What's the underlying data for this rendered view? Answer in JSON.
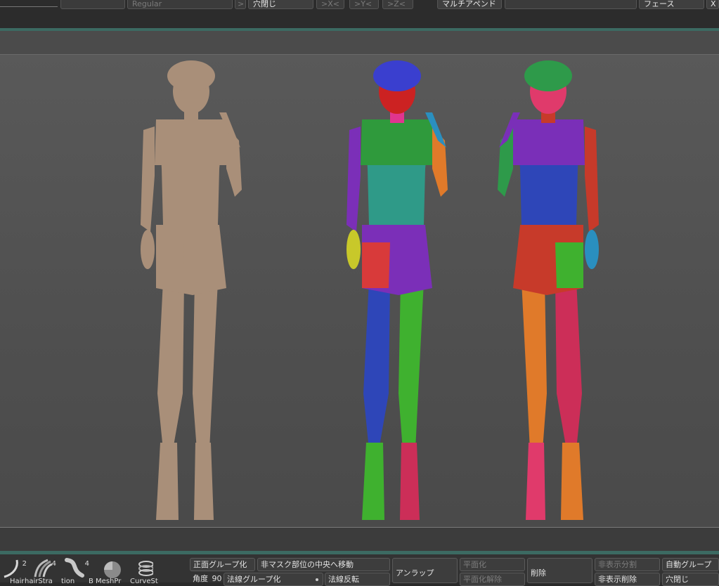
{
  "top_toolbar": {
    "font_style_value": "Regular",
    "arrow_label": ">",
    "close_holes_label": "穴閉じ",
    "axis_x_label": ">X<",
    "axis_y_label": ">Y<",
    "axis_z_label": ">Z<",
    "multi_append_label": "マルチアペンド",
    "face_label": "フェース",
    "close_label": "X"
  },
  "viewport": {
    "models": [
      {
        "name": "sculpt-front",
        "colors": [
          "#a98f79"
        ]
      },
      {
        "name": "polygroup-front",
        "colors": [
          "#cc2222",
          "#3a3fcf",
          "#2f9a3c",
          "#7b2fb8",
          "#2f9a88",
          "#d83a3a",
          "#2e46b8",
          "#3fb12f",
          "#c8c82a",
          "#cc2e58",
          "#e07a2a",
          "#2a8fbf",
          "#e0358f"
        ]
      },
      {
        "name": "polygroup-back",
        "colors": [
          "#e03a6b",
          "#2e9a4a",
          "#7a2fb8",
          "#c73a2a",
          "#2e46b8",
          "#3fb12f",
          "#cc2e58",
          "#e07a2a",
          "#2a8fbf"
        ]
      }
    ]
  },
  "brushes": [
    {
      "icon": "hair-curve-icon",
      "count": "2",
      "label": "Hair"
    },
    {
      "icon": "hair-strand-icon",
      "count": "4",
      "label": "hairStra"
    },
    {
      "icon": "tentacle-icon",
      "count": "4",
      "label": "tion"
    },
    {
      "icon": "sphere-icon",
      "count": "",
      "label": "B MeshPr"
    },
    {
      "icon": "curve-stroke-icon",
      "count": "",
      "label": "CurveSt"
    }
  ],
  "polygroups": {
    "front_group_label": "正面グループ化",
    "move_center_label": "非マスク部位の中央へ移動",
    "unwrap_label": "アンラップ",
    "flatten_label": "平面化",
    "unflatten_label": "平面化解除",
    "delete_label": "削除",
    "hidden_split_label": "非表示分割",
    "hidden_delete_label": "非表示削除",
    "auto_group_label": "自動グループ",
    "angle_label": "角度",
    "angle_value": "90",
    "normal_group_label": "法線グループ化",
    "normal_flip_label": "法線反転",
    "close_holes_label": "穴閉じ"
  }
}
